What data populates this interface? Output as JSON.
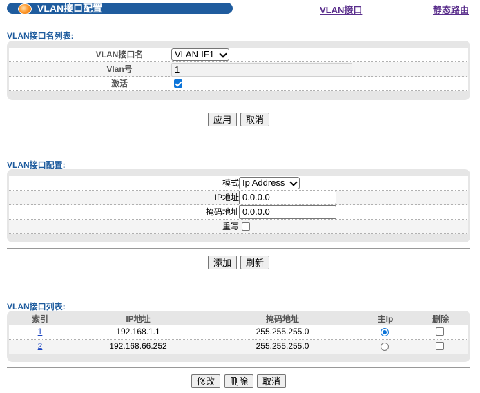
{
  "header": {
    "title": "VLAN接口配置",
    "link_vlan": "VLAN接口",
    "link_route": "静态路由"
  },
  "name_list": {
    "section_title": "VLAN接口名列表:",
    "name_label": "VLAN接口名",
    "name_value": "VLAN-IF1",
    "vlan_label": "Vlan号",
    "vlan_value": "1",
    "active_label": "激活",
    "active_checked": true,
    "apply_label": "应用",
    "cancel_label": "取消"
  },
  "config": {
    "section_title": "VLAN接口配置:",
    "mode_label": "模式",
    "mode_value": "Ip Address",
    "ip_label": "IP地址",
    "ip_value": "0.0.0.0",
    "mask_label": "掩码地址",
    "mask_value": "0.0.0.0",
    "rewrite_label": "重写",
    "rewrite_checked": false,
    "add_label": "添加",
    "refresh_label": "刷新"
  },
  "iface_list": {
    "section_title": "VLAN接口列表:",
    "columns": [
      "索引",
      "IP地址",
      "掩码地址",
      "主Ip",
      "删除"
    ],
    "rows": [
      {
        "index": "1",
        "ip": "192.168.1.1",
        "mask": "255.255.255.0",
        "primary": true,
        "delete": false
      },
      {
        "index": "2",
        "ip": "192.168.66.252",
        "mask": "255.255.255.0",
        "primary": false,
        "delete": false
      }
    ],
    "modify_label": "修改",
    "delete_label": "删除",
    "cancel_label": "取消"
  },
  "colors": {
    "header_bar": "#1f5c9e",
    "section_title": "#1f5c9e",
    "top_link": "#5a2e8c",
    "accent": "#0b74d9"
  }
}
